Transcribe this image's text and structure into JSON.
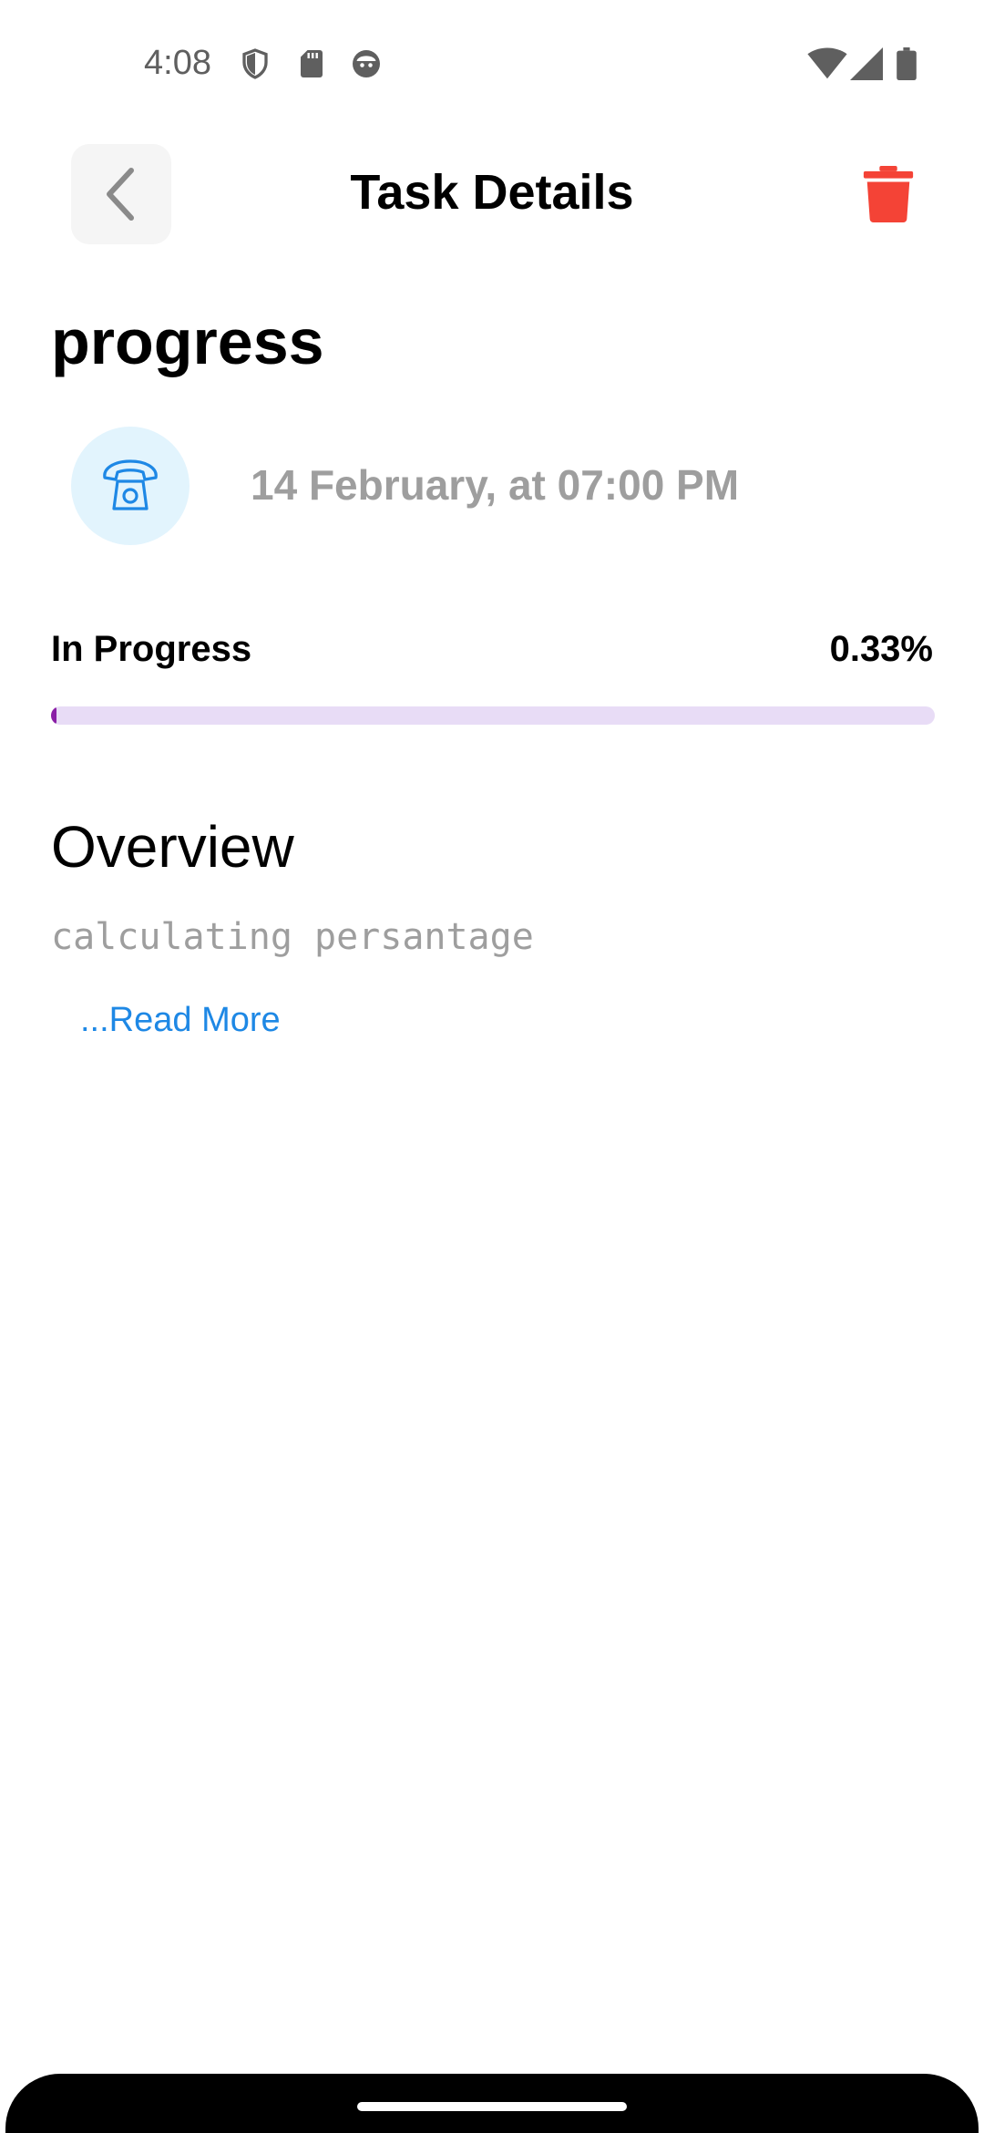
{
  "status_bar": {
    "time": "4:08",
    "left_icons": [
      "shield-icon",
      "sd-card-icon",
      "face-icon"
    ],
    "right_icons": [
      "wifi-icon",
      "signal-icon",
      "battery-icon"
    ]
  },
  "header": {
    "title": "Task Details",
    "back_icon": "chevron-left-icon",
    "delete_icon": "trash-icon",
    "delete_color": "#f44336"
  },
  "task": {
    "title": "progress",
    "category_icon": "telephone-icon",
    "date": "14 February, at 07:00 PM"
  },
  "progress": {
    "label": "In Progress",
    "value_text": "0.33%",
    "value_percent": 0.33,
    "track_color": "#e8dcf6",
    "fill_color": "#8a1fa6"
  },
  "overview": {
    "heading": "Overview",
    "text": "calculating persantage",
    "read_more": "...Read More",
    "link_color": "#1e88e5"
  }
}
